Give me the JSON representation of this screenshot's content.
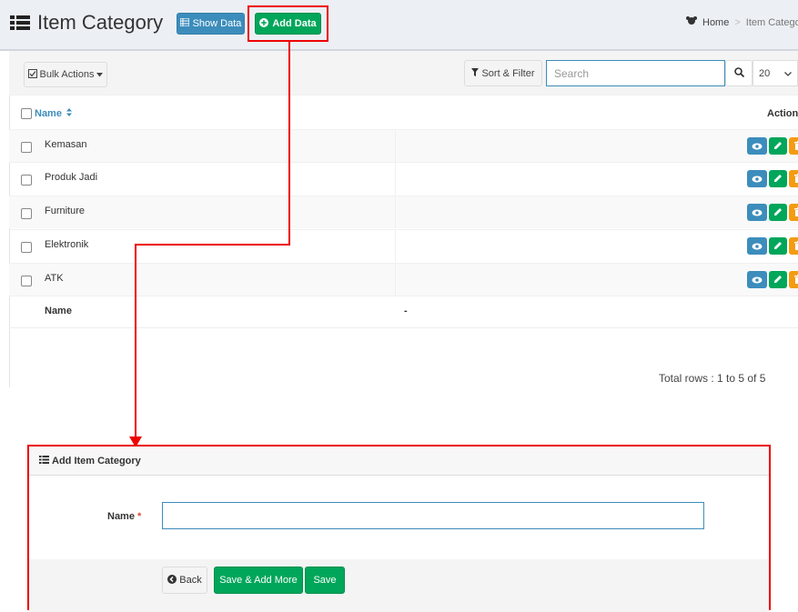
{
  "header": {
    "title": "Item Category",
    "show_data_label": "Show Data",
    "add_data_label": "Add Data",
    "breadcrumb_home": "Home",
    "breadcrumb_separator": ">",
    "breadcrumb_current": "Item Categor"
  },
  "toolbar": {
    "bulk_actions_label": "Bulk Actions",
    "sort_filter_label": "Sort & Filter",
    "search_placeholder": "Search",
    "page_size": "20"
  },
  "table": {
    "columns": [
      "Name",
      "Action"
    ],
    "rows": [
      {
        "name": "Kemasan"
      },
      {
        "name": "Produk Jadi"
      },
      {
        "name": "Furniture"
      },
      {
        "name": "Elektronik"
      },
      {
        "name": "ATK"
      }
    ],
    "footer_name": "Name",
    "footer_value": "-",
    "total_rows": "Total rows : 1 to 5 of 5"
  },
  "form": {
    "title": "Add Item Category",
    "name_label": "Name",
    "required_mark": "*",
    "name_value": "",
    "back_label": "Back",
    "save_add_more_label": "Save & Add More",
    "save_label": "Save"
  },
  "colors": {
    "primary": "#3c8dbc",
    "success": "#00a65a",
    "warning": "#f39c12",
    "highlight": "#ee0000"
  },
  "icons": [
    "list-icon",
    "table-icon",
    "plus-circle-icon",
    "home-icon",
    "check-square-icon",
    "caret-down-icon",
    "filter-icon",
    "search-icon",
    "sort-icon",
    "eye-icon",
    "pencil-icon",
    "trash-icon",
    "chevron-left-icon"
  ]
}
